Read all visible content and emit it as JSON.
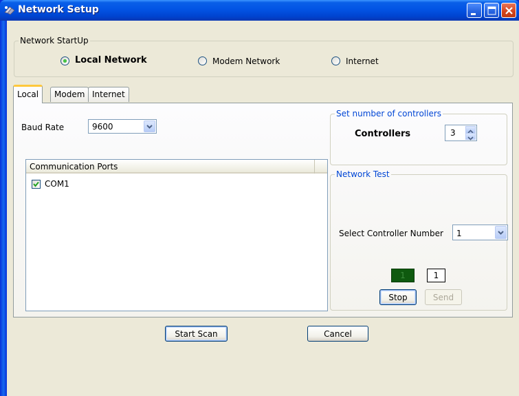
{
  "window": {
    "title": "Network Setup"
  },
  "startup": {
    "legend": "Network StartUp",
    "options": [
      {
        "label": "Local Network",
        "selected": true
      },
      {
        "label": "Modem Network",
        "selected": false
      },
      {
        "label": "Internet",
        "selected": false
      }
    ]
  },
  "tabs": [
    {
      "label": "Local",
      "active": true
    },
    {
      "label": "Modem",
      "active": false
    },
    {
      "label": "Internet",
      "active": false
    }
  ],
  "local": {
    "baud_label": "Baud Rate",
    "baud_value": "9600",
    "ports_header": "Communication Ports",
    "ports": [
      {
        "label": "COM1",
        "checked": true
      }
    ]
  },
  "controllers": {
    "legend": "Set number of controllers",
    "label": "Controllers",
    "value": "3"
  },
  "network_test": {
    "legend": "Network Test",
    "select_label": "Select Controller Number",
    "select_value": "1",
    "indicator_value": "1",
    "count_value": "1",
    "stop_label": "Stop",
    "send_label": "Send"
  },
  "footer": {
    "start_label": "Start Scan",
    "cancel_label": "Cancel"
  },
  "colors": {
    "title_blue": "#0054e3",
    "indicator_green": "#0f5a0f",
    "check_green": "#21a121",
    "tab_highlight": "#ffc83c"
  }
}
